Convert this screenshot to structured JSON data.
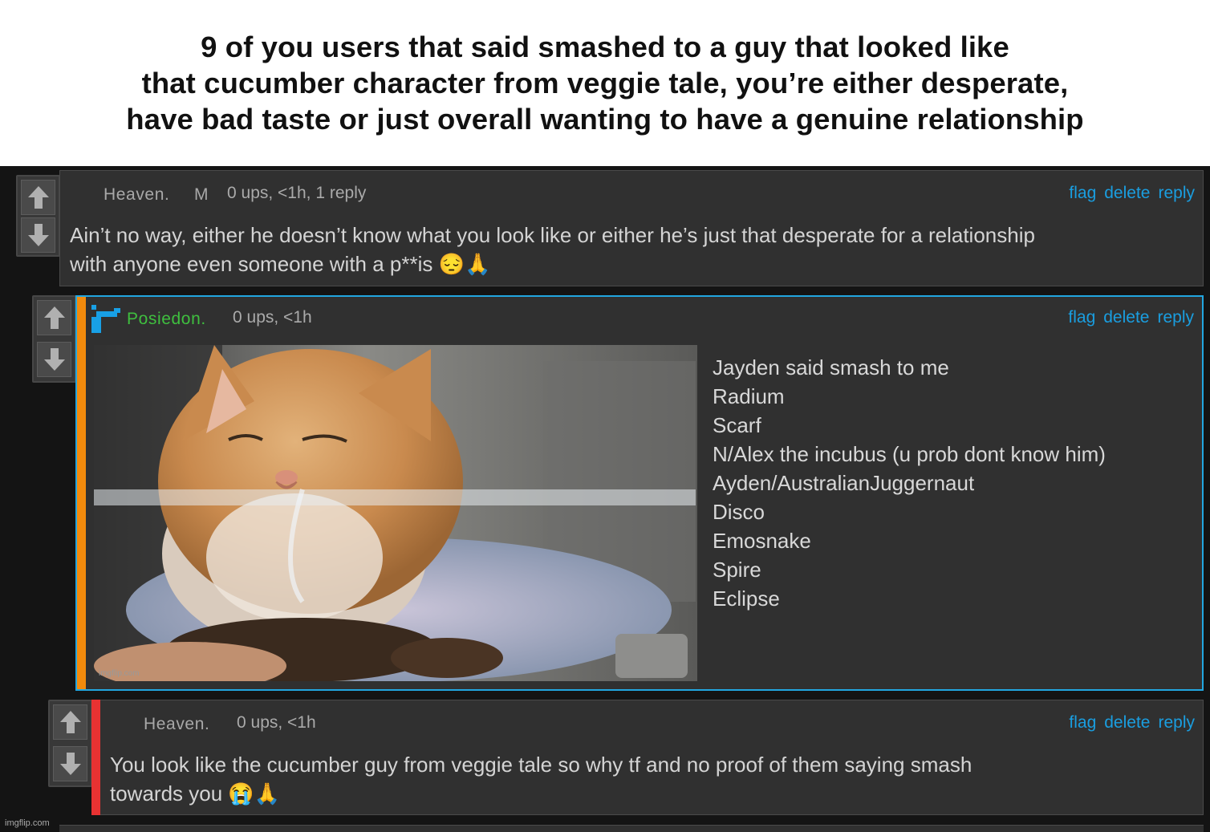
{
  "caption": {
    "text": "9 of you users that said smashed to a guy that looked like\nthat cucumber character from veggie tale, you’re either desperate,\nhave bad taste or just overall wanting to have a genuine relationship"
  },
  "colors": {
    "link": "#1a9ee0",
    "background": "#141414",
    "comment_bg": "#303030",
    "reply_bar_orange": "#f28a0c",
    "reply_bar_red": "#e83232",
    "highlight_border": "#22a6e0",
    "poster_name": "#3fbf3f"
  },
  "comments": [
    {
      "username": "Heaven.",
      "badge": "M",
      "meta": "0 ups, <1h, 1 reply",
      "actions": {
        "flag": "flag",
        "delete": "delete",
        "reply": "reply"
      },
      "text": "Ain’t no way, either he doesn’t know what you look like or either he’s just that desperate for a relationship\nwith anyone even someone with a p**is 😔🙏"
    },
    {
      "username": "Posiedon.",
      "meta": "0 ups, <1h",
      "actions": {
        "flag": "flag",
        "delete": "delete",
        "reply": "reply"
      },
      "image_watermark": "imgflip.com",
      "list": [
        "Jayden said smash to me",
        "Radium",
        "Scarf",
        "N/Alex the incubus (u prob dont know him)",
        "Ayden/AustralianJuggernaut",
        "Disco",
        "Emosnake",
        "Spire",
        "Eclipse"
      ]
    },
    {
      "username": "Heaven.",
      "meta": "0 ups, <1h",
      "actions": {
        "flag": "flag",
        "delete": "delete",
        "reply": "reply"
      },
      "text": "You look like the cucumber guy from veggie tale so why tf and no proof of them saying smash\ntowards you 😭🙏"
    }
  ],
  "footer_watermark": "imgflip.com"
}
